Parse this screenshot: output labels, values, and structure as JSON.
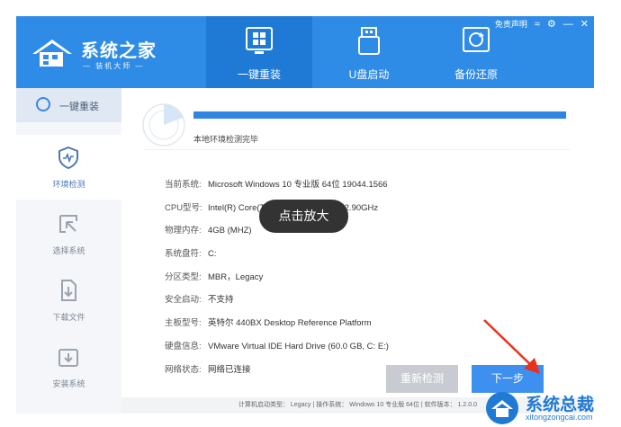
{
  "header": {
    "app_title": "系统之家",
    "app_subtitle": "— 装机大师 —",
    "disclaimer": "免责声明",
    "tabs": [
      {
        "label": "一键重装",
        "icon": "windows-install-icon",
        "active": true
      },
      {
        "label": "U盘启动",
        "icon": "usb-drive-icon",
        "active": false
      },
      {
        "label": "备份还原",
        "icon": "backup-restore-icon",
        "active": false
      }
    ]
  },
  "sidebar": {
    "main_label": "一键重装",
    "items": [
      {
        "label": "环境检测",
        "icon": "shield-heartbeat-icon",
        "active": true
      },
      {
        "label": "选择系统",
        "icon": "select-cursor-icon",
        "active": false
      },
      {
        "label": "下载文件",
        "icon": "download-file-icon",
        "active": false
      },
      {
        "label": "安装系统",
        "icon": "install-box-icon",
        "active": false
      }
    ]
  },
  "progress": {
    "status_text": "本地环境检测完毕",
    "percent": 100
  },
  "system_info": [
    {
      "key": "当前系统:",
      "value": "Microsoft Windows 10 专业版 64位 19044.1566"
    },
    {
      "key": "CPU型号:",
      "value": "Intel(R) Core(TM) i7-10700 CPU @ 2.90GHz"
    },
    {
      "key": "物理内存:",
      "value": "4GB (MHZ)"
    },
    {
      "key": "系统盘符:",
      "value": "C:"
    },
    {
      "key": "分区类型:",
      "value": "MBR，Legacy"
    },
    {
      "key": "安全启动:",
      "value": "不支持"
    },
    {
      "key": "主板型号:",
      "value": "英特尔 440BX Desktop Reference Platform"
    },
    {
      "key": "硬盘信息:",
      "value": "VMware Virtual IDE Hard Drive  (60.0 GB, C: E:)"
    },
    {
      "key": "网络状态:",
      "value": "网络已连接"
    }
  ],
  "tooltip": "点击放大",
  "buttons": {
    "recheck": "重新检测",
    "next": "下一步"
  },
  "statusbar": "计算机启动类型： Legacy | 操作系统： Windows 10 专业版 64位 | 软件版本： 1.2.0.0",
  "watermark": {
    "title": "系统总裁",
    "url": "xitongzongcai.com"
  },
  "colors": {
    "header_blue": "#2f8ce6",
    "active_tab": "#1f7ad6",
    "button_blue": "#3d8ff0",
    "arrow_red": "#e8321e"
  }
}
